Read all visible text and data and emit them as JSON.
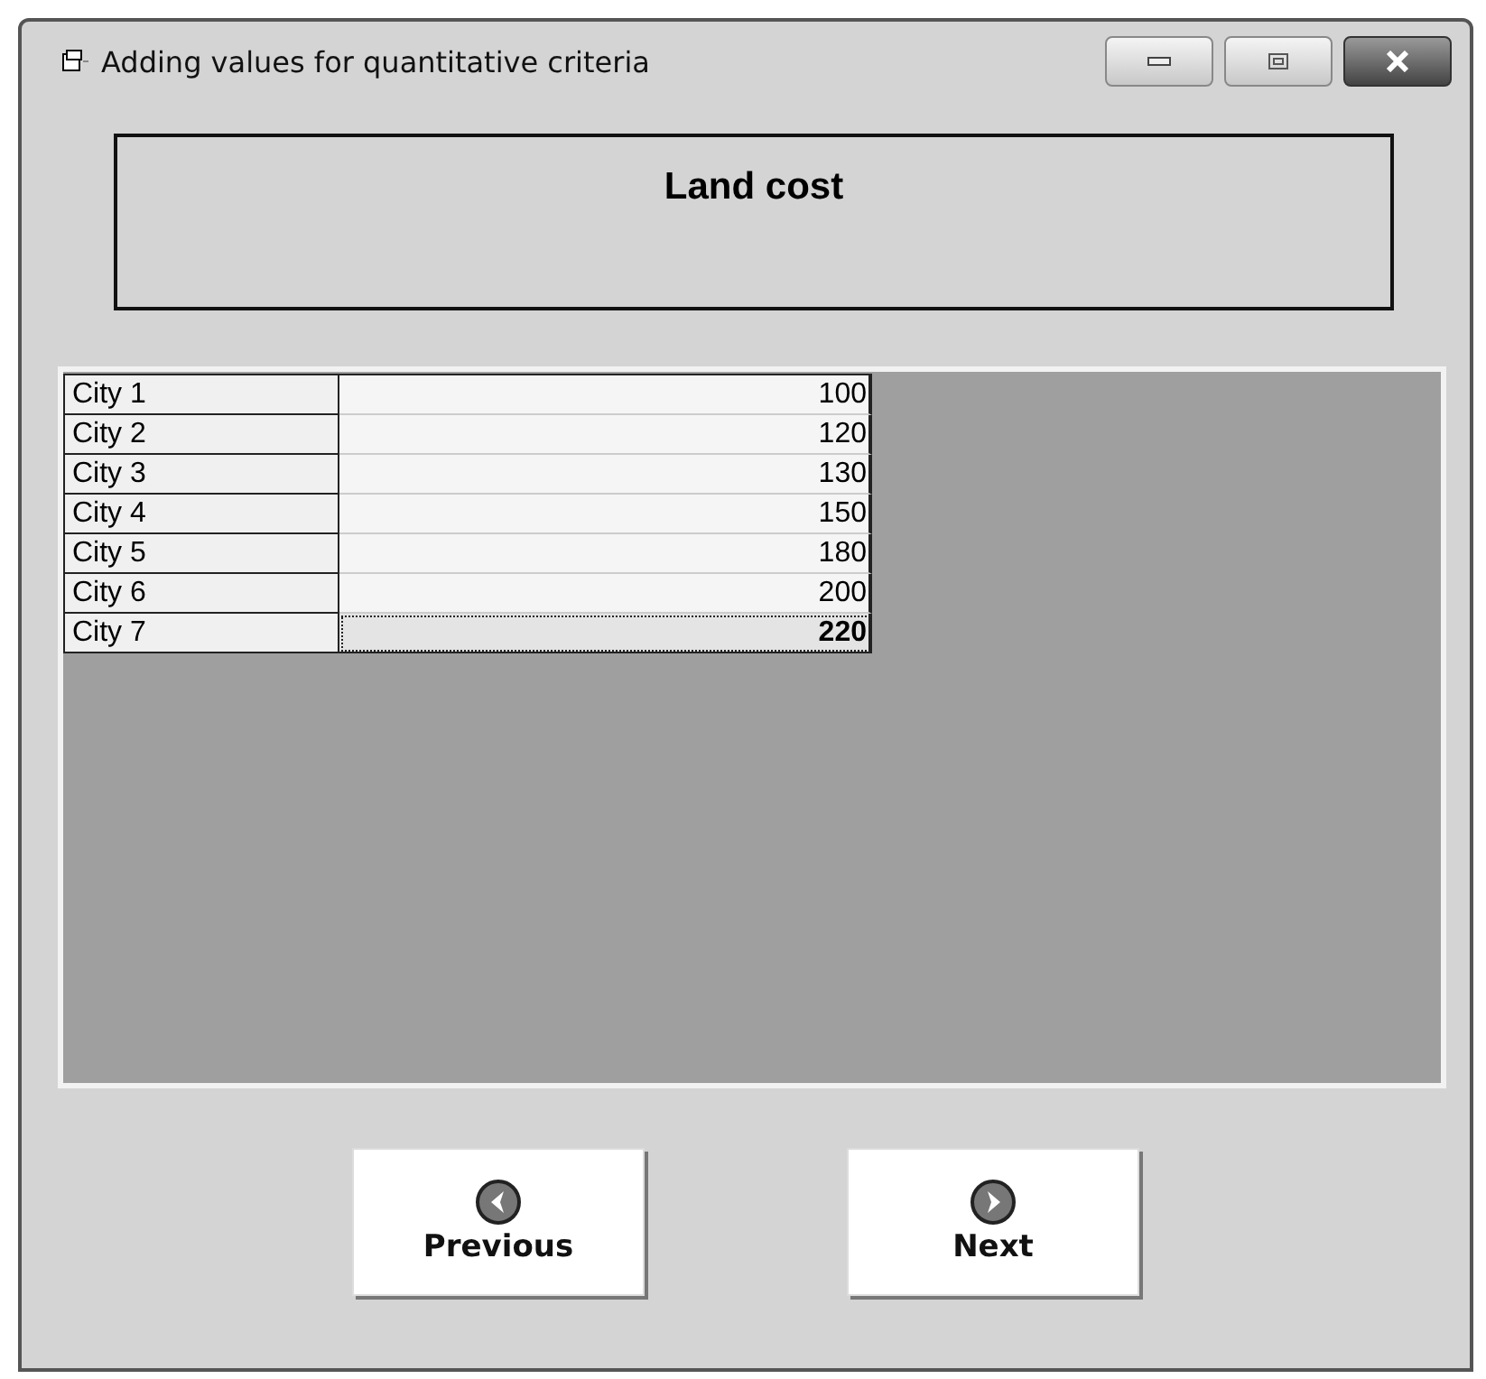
{
  "window": {
    "title": "Adding values for quantitative criteria"
  },
  "header": {
    "title": "Land cost"
  },
  "table": {
    "rows": [
      {
        "name": "City 1",
        "value": "100",
        "selected": false
      },
      {
        "name": "City 2",
        "value": "120",
        "selected": false
      },
      {
        "name": "City 3",
        "value": "130",
        "selected": false
      },
      {
        "name": "City 4",
        "value": "150",
        "selected": false
      },
      {
        "name": "City 5",
        "value": "180",
        "selected": false
      },
      {
        "name": "City 6",
        "value": "200",
        "selected": false
      },
      {
        "name": "City 7",
        "value": "220",
        "selected": true
      }
    ]
  },
  "buttons": [
    {
      "label": "Previous",
      "kind": "previous"
    },
    {
      "label": "Next",
      "kind": "next"
    }
  ]
}
